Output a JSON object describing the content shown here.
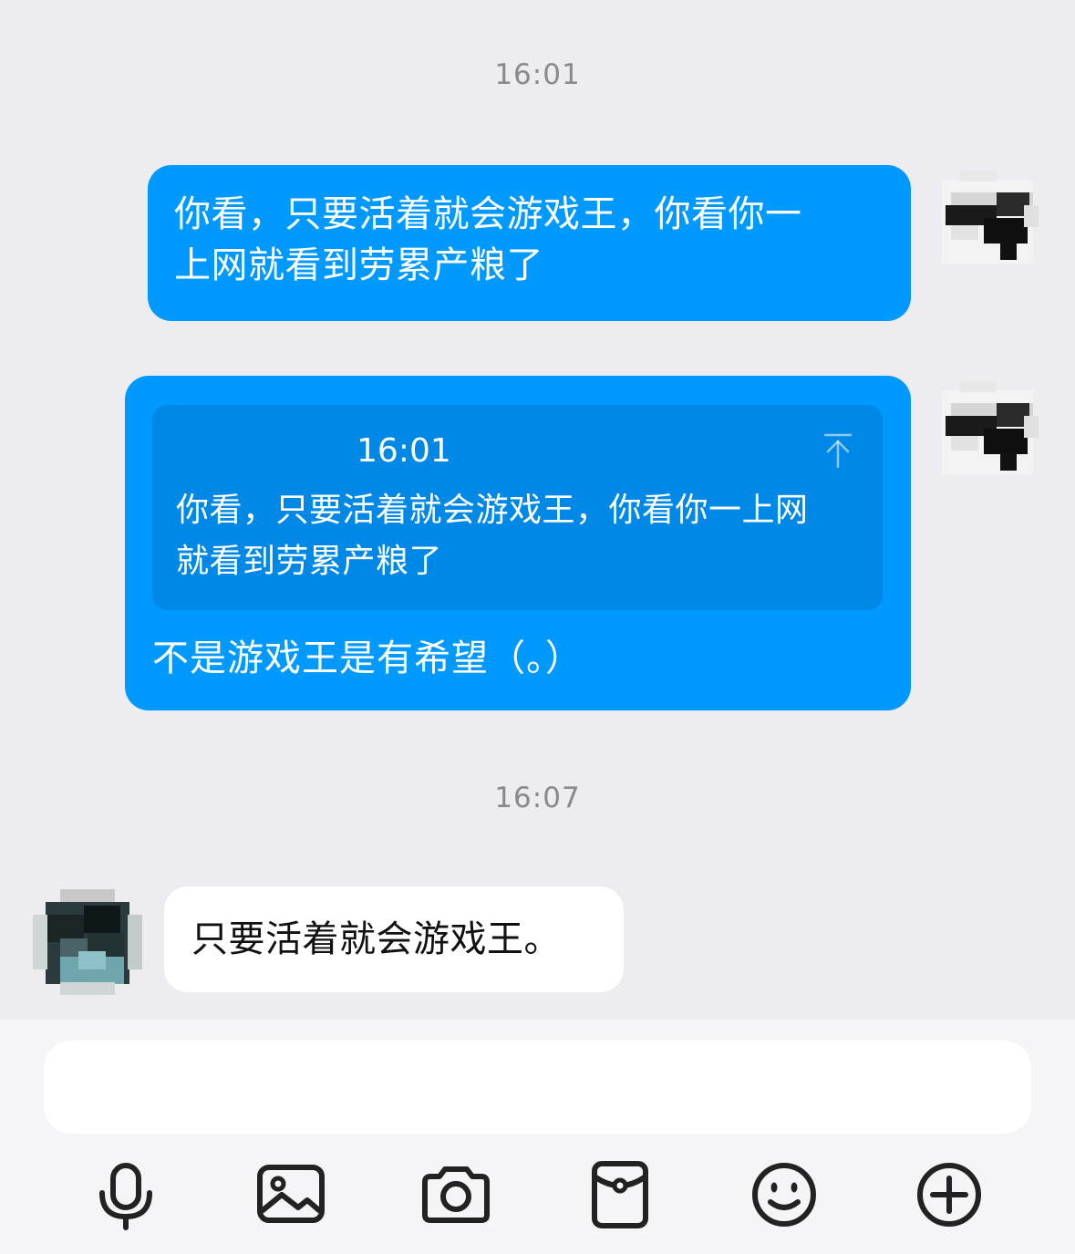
{
  "conversation": {
    "timestamps": [
      "16:01",
      "16:07"
    ],
    "messages": [
      {
        "direction": "outgoing",
        "text": "你看，只要活着就会游戏王，你看你一\n上网就看到劳累产粮了"
      },
      {
        "direction": "outgoing",
        "quote": {
          "time": "16:01",
          "text": "你看，只要活着就会游戏王，你看你一上网\n就看到劳累产粮了"
        },
        "text": "不是游戏王是有希望（。）"
      },
      {
        "direction": "incoming",
        "text": "只要活着就会游戏王。"
      }
    ]
  },
  "composer": {
    "input_value": "",
    "toolbar": [
      "microphone-icon",
      "image-icon",
      "camera-icon",
      "red-packet-icon",
      "emoji-icon",
      "plus-icon"
    ]
  },
  "colors": {
    "chat_background": "#ededf1",
    "outgoing_bubble": "#0099ff",
    "quote_box": "#0088e6",
    "incoming_bubble": "#ffffff",
    "timestamp_text": "#8a8a8e",
    "icon_stroke": "#222222"
  }
}
